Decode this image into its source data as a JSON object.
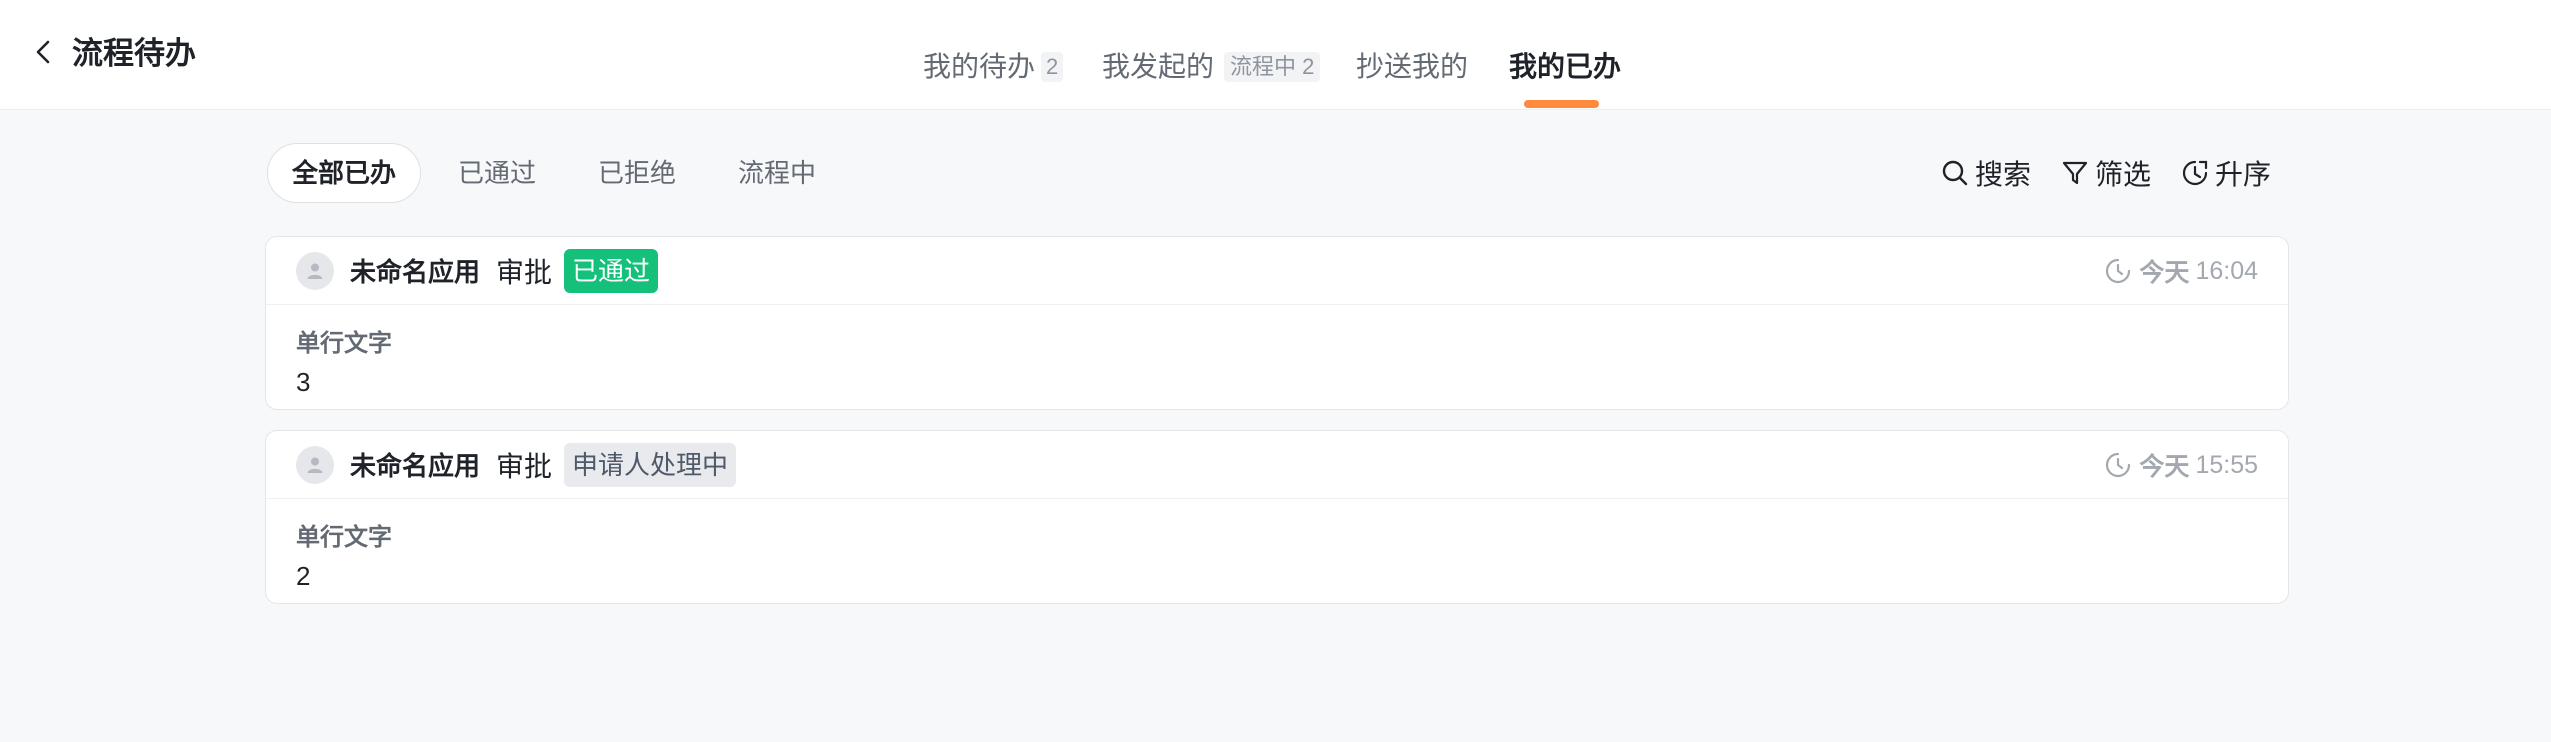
{
  "header": {
    "back_icon": "chevron-left-icon",
    "title": "流程待办"
  },
  "tabs": [
    {
      "label": "我的待办",
      "badge": "2"
    },
    {
      "label": "我发起的",
      "badge": "流程中 2"
    },
    {
      "label": "抄送我的"
    },
    {
      "label": "我的已办",
      "active": true
    }
  ],
  "filters": [
    "全部已办",
    "已通过",
    "已拒绝",
    "流程中"
  ],
  "actions": {
    "search": "搜索",
    "filter": "筛选",
    "sort": "升序"
  },
  "cards": [
    {
      "app": "未命名应用",
      "kind": "审批",
      "status": "已通过",
      "day": "今天",
      "time": "16:04",
      "field_label": "单行文字",
      "field_value": "3"
    },
    {
      "app": "未命名应用",
      "kind": "审批",
      "status": "申请人处理中",
      "day": "今天",
      "time": "15:55",
      "field_label": "单行文字",
      "field_value": "2"
    }
  ],
  "colors": {
    "accent": "#ff8a3d",
    "status_passed": "#14c07a",
    "status_processing": "#e8eaee"
  }
}
